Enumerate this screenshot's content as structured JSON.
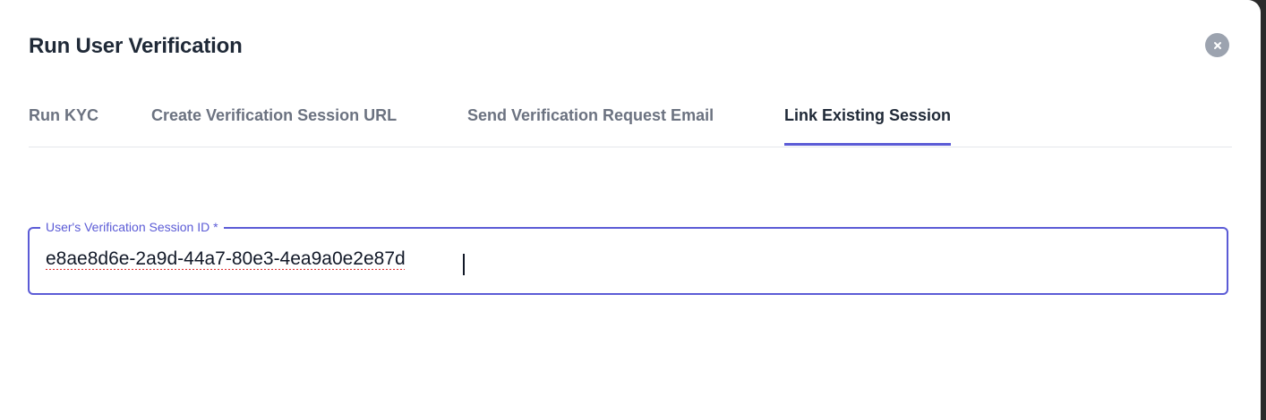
{
  "dialog": {
    "title": "Run User Verification",
    "close_icon": "close-icon"
  },
  "tabs": [
    {
      "label": "Run KYC",
      "active": false
    },
    {
      "label": "Create Verification Session URL",
      "active": false
    },
    {
      "label": "Send Verification Request Email",
      "active": false
    },
    {
      "label": "Link Existing Session",
      "active": true
    }
  ],
  "session_field": {
    "label": "User's Verification Session ID *",
    "value": "e8ae8d6e-2a9d-44a7-80e3-4ea9a0e2e87d"
  },
  "colors": {
    "accent": "#5b5bd6",
    "title_text": "#1f2937",
    "inactive_tab": "#6b7280",
    "close_button": "#9ca3af"
  }
}
